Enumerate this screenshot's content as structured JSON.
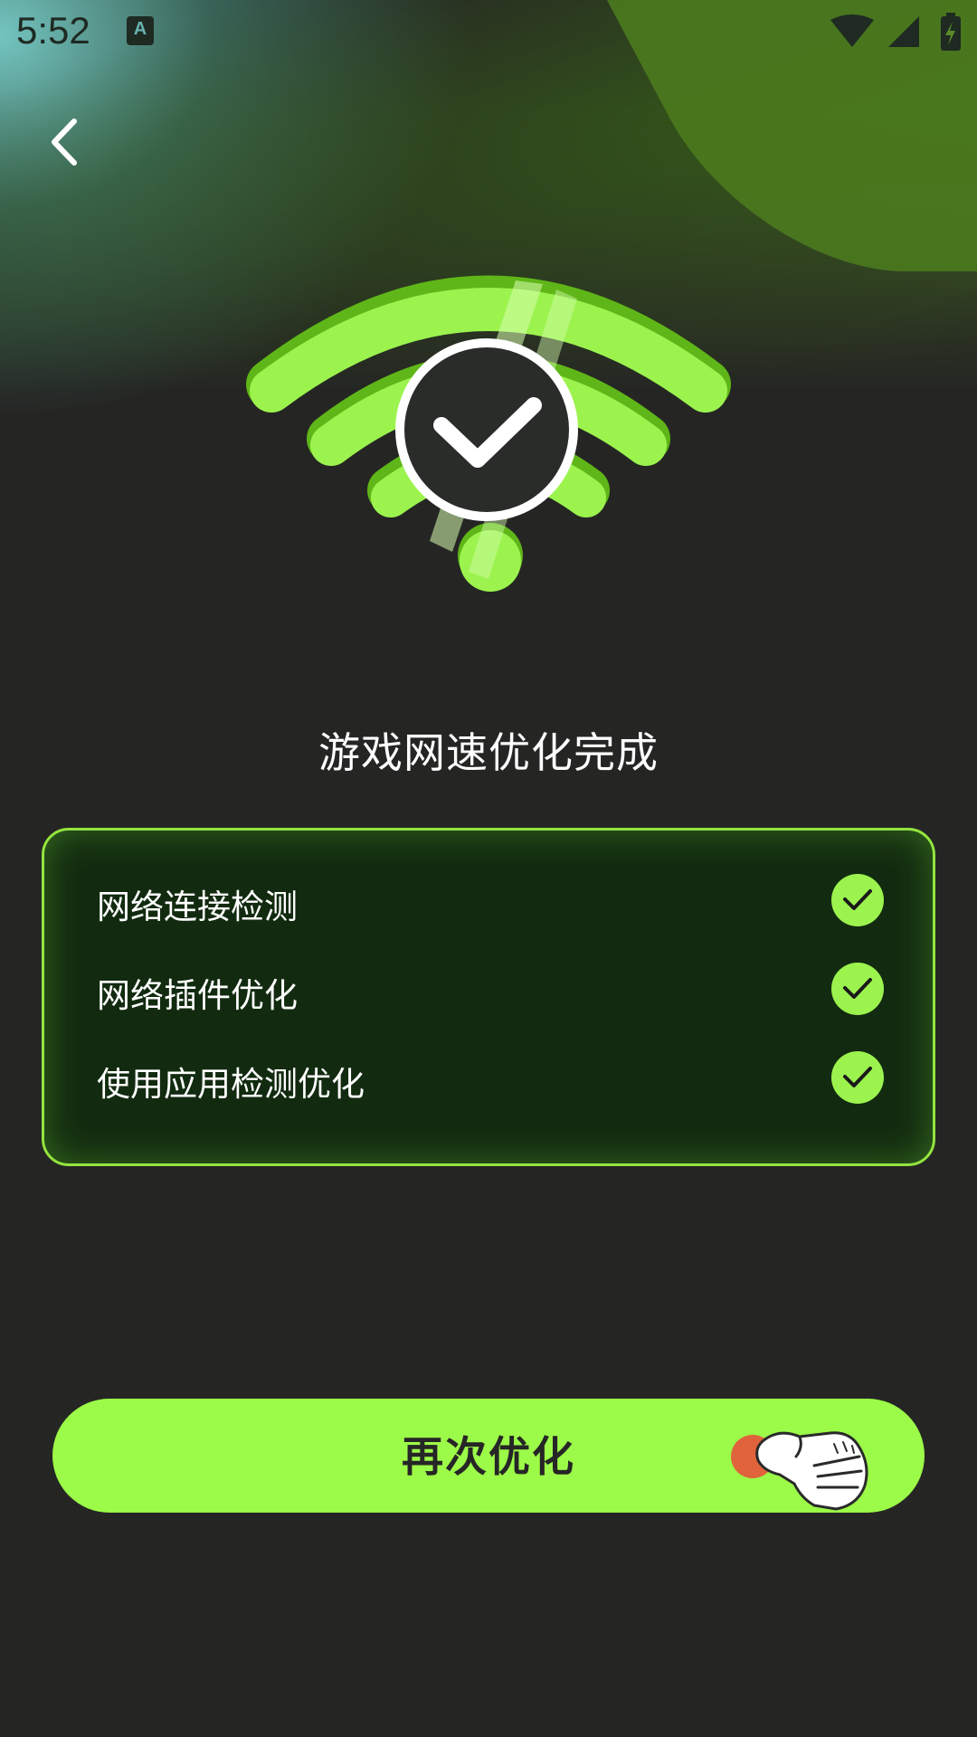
{
  "status_bar": {
    "time": "5:52",
    "keyboard_icon": "A"
  },
  "header": {
    "back_icon": "chevron-left-icon"
  },
  "hero": {
    "icon": "wifi-check-icon",
    "accent_color": "#9cf34e"
  },
  "result": {
    "title": "游戏网速优化完成"
  },
  "checklist": {
    "items": [
      {
        "label": "网络连接检测",
        "status": "done"
      },
      {
        "label": "网络插件优化",
        "status": "done"
      },
      {
        "label": "使用应用检测优化",
        "status": "done"
      }
    ]
  },
  "actions": {
    "reoptimize_label": "再次优化",
    "hand_icon": "pointing-hand-icon"
  },
  "colors": {
    "background": "#252624",
    "accent": "#9cfa48",
    "card_bg": "#122b10",
    "pointer_dot": "#e0633b"
  }
}
